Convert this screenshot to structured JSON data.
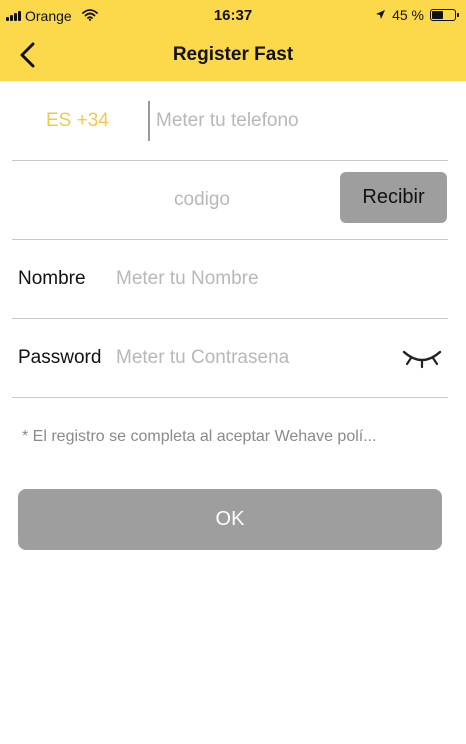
{
  "status_bar": {
    "carrier": "Orange",
    "time": "16:37",
    "battery_text": "45 %",
    "battery_level": 0.45,
    "icons": [
      "signal-icon",
      "wifi-icon",
      "location-arrow-icon",
      "battery-icon"
    ]
  },
  "nav": {
    "title": "Register Fast",
    "back_icon": "chevron-left-icon"
  },
  "phone": {
    "country_code": "ES +34",
    "placeholder": "Meter tu telefono"
  },
  "code": {
    "placeholder": "codigo",
    "button_label": "Recibir"
  },
  "name": {
    "label": "Nombre",
    "placeholder": "Meter tu Nombre"
  },
  "password": {
    "label": "Password",
    "placeholder": "Meter tu Contrasena",
    "toggle_icon": "eye-closed-icon"
  },
  "notice": "* El registro se completa al aceptar Wehave polí...",
  "submit": {
    "label": "OK"
  },
  "colors": {
    "header_bg": "#fbd94b",
    "accent": "#f2c94c",
    "button_bg": "#9e9e9e",
    "divider": "#c9c9c9",
    "placeholder": "#b8b8b8"
  }
}
